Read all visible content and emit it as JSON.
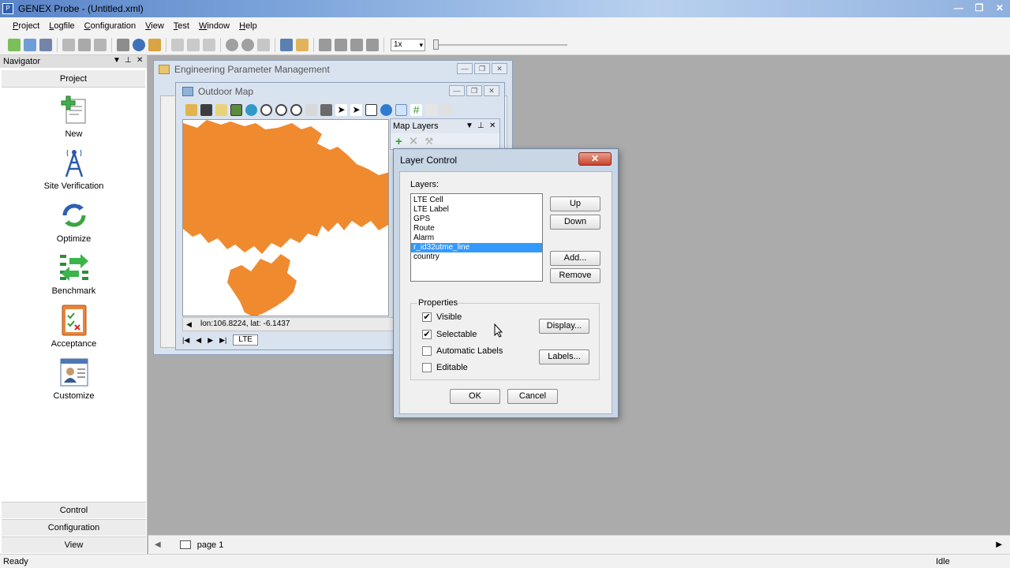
{
  "app": {
    "title": "GENEX Probe - (Untitled.xml)",
    "icon": "app-logo-icon"
  },
  "menu": [
    "Project",
    "Logfile",
    "Configuration",
    "View",
    "Test",
    "Window",
    "Help"
  ],
  "toolbar": {
    "speed": "1x",
    "playback_progress": 0.0
  },
  "navigator": {
    "title": "Navigator",
    "section": "Project",
    "items": [
      {
        "label": "New",
        "icon": "new-project-icon"
      },
      {
        "label": "Site Verification",
        "icon": "antenna-tower-icon"
      },
      {
        "label": "Optimize",
        "icon": "optimize-cycle-icon"
      },
      {
        "label": "Benchmark",
        "icon": "benchmark-arrows-icon"
      },
      {
        "label": "Acceptance",
        "icon": "acceptance-checklist-icon"
      },
      {
        "label": "Customize",
        "icon": "customize-user-icon"
      }
    ],
    "bottom_sections": [
      "Control",
      "Configuration",
      "View"
    ]
  },
  "engineering_window": {
    "title": "Engineering Parameter Management"
  },
  "map_window": {
    "title": "Outdoor Map",
    "coordinates": "lon:106.8224, lat: -6.1437",
    "tab": "LTE",
    "map_color": "#ef8a2f"
  },
  "map_layers": {
    "title": "Map Layers"
  },
  "layer_control": {
    "title": "Layer Control",
    "layers_label": "Layers:",
    "layers": [
      "LTE Cell",
      "LTE Label",
      "GPS",
      "Route",
      "Alarm",
      "r_id32utme_line",
      "country"
    ],
    "selected_layer": "r_id32utme_line",
    "buttons": {
      "up": "Up",
      "down": "Down",
      "add": "Add...",
      "remove": "Remove",
      "display": "Display...",
      "labels": "Labels...",
      "ok": "OK",
      "cancel": "Cancel"
    },
    "properties_label": "Properties",
    "properties": [
      {
        "label": "Visible",
        "checked": true
      },
      {
        "label": "Selectable",
        "checked": true
      },
      {
        "label": "Automatic Labels",
        "checked": false
      },
      {
        "label": "Editable",
        "checked": false
      }
    ]
  },
  "page_tab": "page 1",
  "status": {
    "left": "Ready",
    "right": "Idle"
  }
}
